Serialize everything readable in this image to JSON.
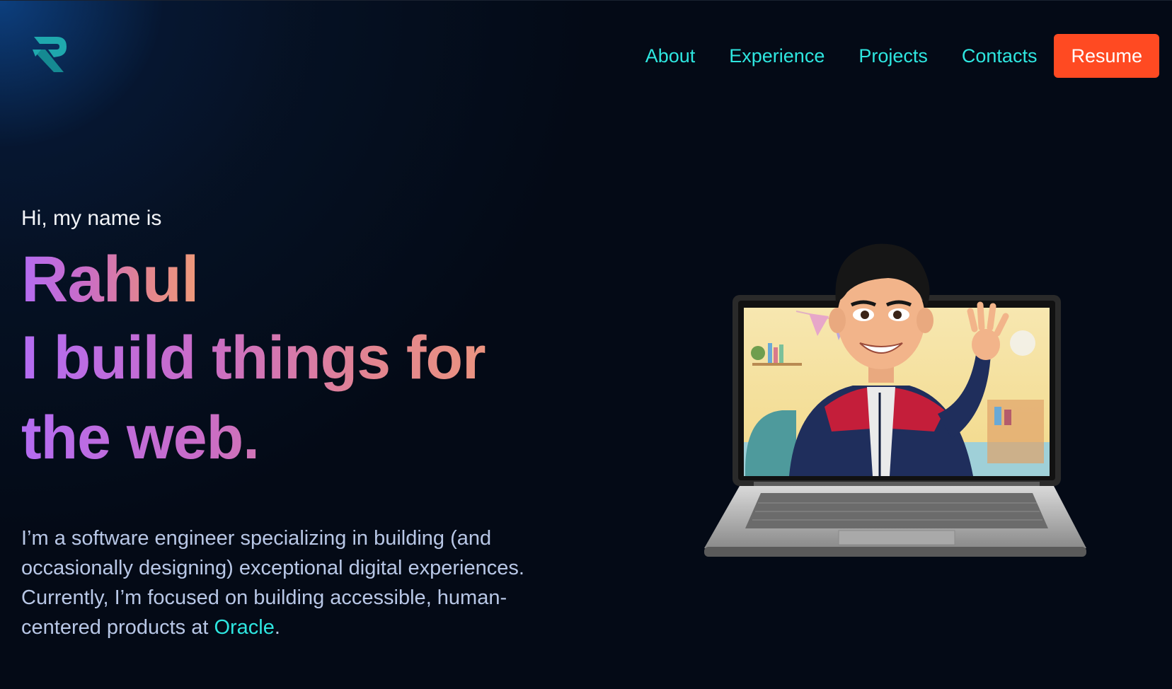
{
  "brand": {
    "logo_icon": "r-monogram-logo-icon",
    "logo_color": "#1fa8ad"
  },
  "nav": {
    "items": [
      {
        "label": "About"
      },
      {
        "label": "Experience"
      },
      {
        "label": "Projects"
      },
      {
        "label": "Contacts"
      }
    ],
    "resume_label": "Resume",
    "link_color": "#2ee6e0",
    "resume_color": "#ff4a22"
  },
  "hero": {
    "greeting": "Hi, my name is",
    "name": "Rahul",
    "tagline": "I build things for the web.",
    "intro_before": "I’m a software engineer specializing in building (and occasionally designing) exceptional digital experiences. Currently, I’m focused on building accessible, human-centered products at ",
    "company": "Oracle",
    "intro_after": ".",
    "gradient": [
      "#b46cf2",
      "#ef9a7a"
    ]
  },
  "illustration": {
    "icon": "avatar-waving-from-laptop-illustration"
  }
}
